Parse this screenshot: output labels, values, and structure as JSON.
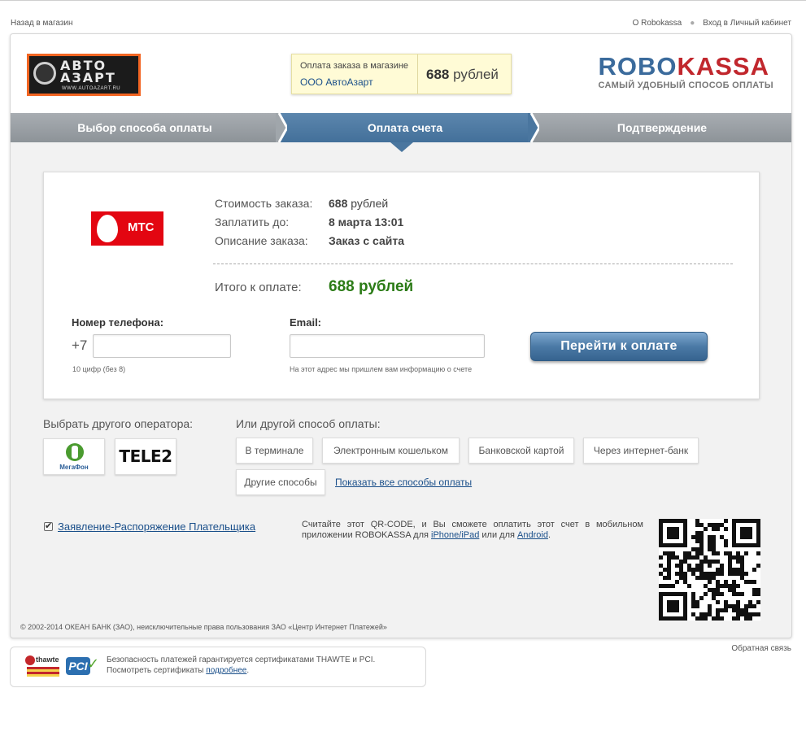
{
  "top_links": {
    "back": "Назад в магазин",
    "about": "О Robokassa",
    "login": "Вход в Личный кабинет"
  },
  "header": {
    "shop_logo_word": "АВТО АЗАРТ",
    "shop_logo_url": "WWW.AUTOAZART.RU",
    "order_label": "Оплата заказа в магазине",
    "shop_name": "ООО АвтоАзарт",
    "amount_num": "688",
    "amount_unit": "рублей",
    "brand_a": "ROBO",
    "brand_b": "KASSA",
    "brand_tagline": "САМЫЙ УДОБНЫЙ СПОСОБ ОПЛАТЫ"
  },
  "steps": [
    {
      "label": "Выбор способа оплаты",
      "active": false
    },
    {
      "label": "Оплата счета",
      "active": true
    },
    {
      "label": "Подтверждение",
      "active": false
    }
  ],
  "operator": {
    "logo_text": "МТС",
    "brand_color": "#e30611"
  },
  "details": {
    "cost_label": "Стоимость заказа:",
    "cost_num": "688",
    "cost_unit": "рублей",
    "due_label": "Заплатить до:",
    "due_value": "8 марта 13:01",
    "desc_label": "Описание заказа:",
    "desc_value": "Заказ с сайта",
    "total_label": "Итого к оплате:",
    "total_value": "688 рублей"
  },
  "form": {
    "phone_label": "Номер телефона:",
    "phone_prefix": "+7",
    "phone_value": "",
    "phone_hint": "10 цифр (без 8)",
    "email_label": "Email:",
    "email_value": "",
    "email_hint": "На этот адрес мы пришлем вам информацию о счете",
    "submit": "Перейти к оплате"
  },
  "other_operator": {
    "title": "Выбрать другого оператора:",
    "megafon": "МегаФон",
    "tele2": "TELE2"
  },
  "other_methods": {
    "title": "Или другой способ оплаты:",
    "items": [
      "В терминале",
      "Электронным кошельком",
      "Банковской картой",
      "Через интернет-банк",
      "Другие способы"
    ],
    "show_all": "Показать все способы оплаты"
  },
  "agreement": {
    "checked": true,
    "label": "Заявление-Распоряжение Плательщика"
  },
  "qr": {
    "text_1": "Считайте этот QR-CODE, и Вы сможете оплатить этот счет в мобильном приложении ROBOKASSA для ",
    "link_1": "iPhone/iPad",
    "text_2": " или для ",
    "link_2": "Android",
    "text_3": "."
  },
  "copyright": "© 2002-2014 ОКЕАН БАНК (ЗАО), неисключительные права пользования ЗАО «Центр Интернет Платежей»",
  "feedback": "Обратная связь",
  "security": {
    "thawte": "thawte",
    "pci": "PCI",
    "line1": "Безопасность платежей гарантируется сертификатами THAWTE и PCI.",
    "line2": "Посмотреть сертификаты ",
    "link": "подробнее",
    "line2_end": "."
  }
}
